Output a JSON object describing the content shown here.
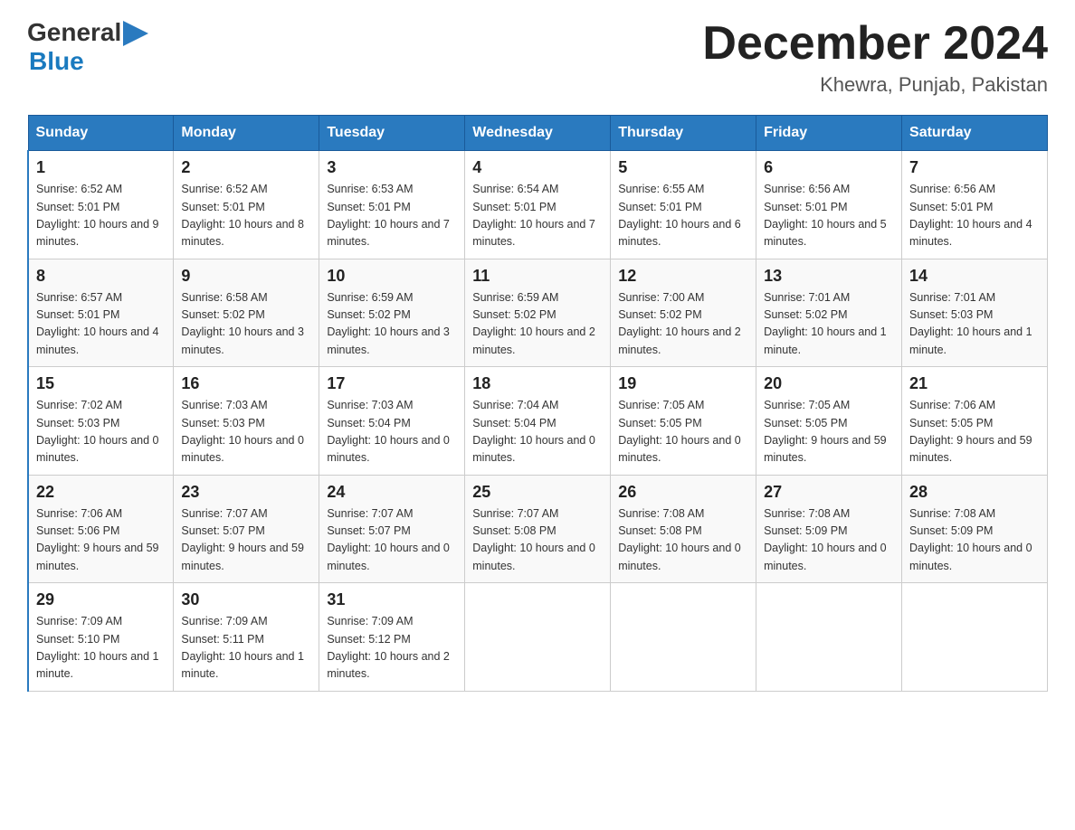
{
  "header": {
    "month_year": "December 2024",
    "location": "Khewra, Punjab, Pakistan",
    "logo_general": "General",
    "logo_blue": "Blue"
  },
  "days_of_week": [
    "Sunday",
    "Monday",
    "Tuesday",
    "Wednesday",
    "Thursday",
    "Friday",
    "Saturday"
  ],
  "weeks": [
    [
      {
        "day": "1",
        "sunrise": "6:52 AM",
        "sunset": "5:01 PM",
        "daylight": "10 hours and 9 minutes."
      },
      {
        "day": "2",
        "sunrise": "6:52 AM",
        "sunset": "5:01 PM",
        "daylight": "10 hours and 8 minutes."
      },
      {
        "day": "3",
        "sunrise": "6:53 AM",
        "sunset": "5:01 PM",
        "daylight": "10 hours and 7 minutes."
      },
      {
        "day": "4",
        "sunrise": "6:54 AM",
        "sunset": "5:01 PM",
        "daylight": "10 hours and 7 minutes."
      },
      {
        "day": "5",
        "sunrise": "6:55 AM",
        "sunset": "5:01 PM",
        "daylight": "10 hours and 6 minutes."
      },
      {
        "day": "6",
        "sunrise": "6:56 AM",
        "sunset": "5:01 PM",
        "daylight": "10 hours and 5 minutes."
      },
      {
        "day": "7",
        "sunrise": "6:56 AM",
        "sunset": "5:01 PM",
        "daylight": "10 hours and 4 minutes."
      }
    ],
    [
      {
        "day": "8",
        "sunrise": "6:57 AM",
        "sunset": "5:01 PM",
        "daylight": "10 hours and 4 minutes."
      },
      {
        "day": "9",
        "sunrise": "6:58 AM",
        "sunset": "5:02 PM",
        "daylight": "10 hours and 3 minutes."
      },
      {
        "day": "10",
        "sunrise": "6:59 AM",
        "sunset": "5:02 PM",
        "daylight": "10 hours and 3 minutes."
      },
      {
        "day": "11",
        "sunrise": "6:59 AM",
        "sunset": "5:02 PM",
        "daylight": "10 hours and 2 minutes."
      },
      {
        "day": "12",
        "sunrise": "7:00 AM",
        "sunset": "5:02 PM",
        "daylight": "10 hours and 2 minutes."
      },
      {
        "day": "13",
        "sunrise": "7:01 AM",
        "sunset": "5:02 PM",
        "daylight": "10 hours and 1 minute."
      },
      {
        "day": "14",
        "sunrise": "7:01 AM",
        "sunset": "5:03 PM",
        "daylight": "10 hours and 1 minute."
      }
    ],
    [
      {
        "day": "15",
        "sunrise": "7:02 AM",
        "sunset": "5:03 PM",
        "daylight": "10 hours and 0 minutes."
      },
      {
        "day": "16",
        "sunrise": "7:03 AM",
        "sunset": "5:03 PM",
        "daylight": "10 hours and 0 minutes."
      },
      {
        "day": "17",
        "sunrise": "7:03 AM",
        "sunset": "5:04 PM",
        "daylight": "10 hours and 0 minutes."
      },
      {
        "day": "18",
        "sunrise": "7:04 AM",
        "sunset": "5:04 PM",
        "daylight": "10 hours and 0 minutes."
      },
      {
        "day": "19",
        "sunrise": "7:05 AM",
        "sunset": "5:05 PM",
        "daylight": "10 hours and 0 minutes."
      },
      {
        "day": "20",
        "sunrise": "7:05 AM",
        "sunset": "5:05 PM",
        "daylight": "9 hours and 59 minutes."
      },
      {
        "day": "21",
        "sunrise": "7:06 AM",
        "sunset": "5:05 PM",
        "daylight": "9 hours and 59 minutes."
      }
    ],
    [
      {
        "day": "22",
        "sunrise": "7:06 AM",
        "sunset": "5:06 PM",
        "daylight": "9 hours and 59 minutes."
      },
      {
        "day": "23",
        "sunrise": "7:07 AM",
        "sunset": "5:07 PM",
        "daylight": "9 hours and 59 minutes."
      },
      {
        "day": "24",
        "sunrise": "7:07 AM",
        "sunset": "5:07 PM",
        "daylight": "10 hours and 0 minutes."
      },
      {
        "day": "25",
        "sunrise": "7:07 AM",
        "sunset": "5:08 PM",
        "daylight": "10 hours and 0 minutes."
      },
      {
        "day": "26",
        "sunrise": "7:08 AM",
        "sunset": "5:08 PM",
        "daylight": "10 hours and 0 minutes."
      },
      {
        "day": "27",
        "sunrise": "7:08 AM",
        "sunset": "5:09 PM",
        "daylight": "10 hours and 0 minutes."
      },
      {
        "day": "28",
        "sunrise": "7:08 AM",
        "sunset": "5:09 PM",
        "daylight": "10 hours and 0 minutes."
      }
    ],
    [
      {
        "day": "29",
        "sunrise": "7:09 AM",
        "sunset": "5:10 PM",
        "daylight": "10 hours and 1 minute."
      },
      {
        "day": "30",
        "sunrise": "7:09 AM",
        "sunset": "5:11 PM",
        "daylight": "10 hours and 1 minute."
      },
      {
        "day": "31",
        "sunrise": "7:09 AM",
        "sunset": "5:12 PM",
        "daylight": "10 hours and 2 minutes."
      },
      null,
      null,
      null,
      null
    ]
  ],
  "labels": {
    "sunrise": "Sunrise:",
    "sunset": "Sunset:",
    "daylight": "Daylight:"
  }
}
